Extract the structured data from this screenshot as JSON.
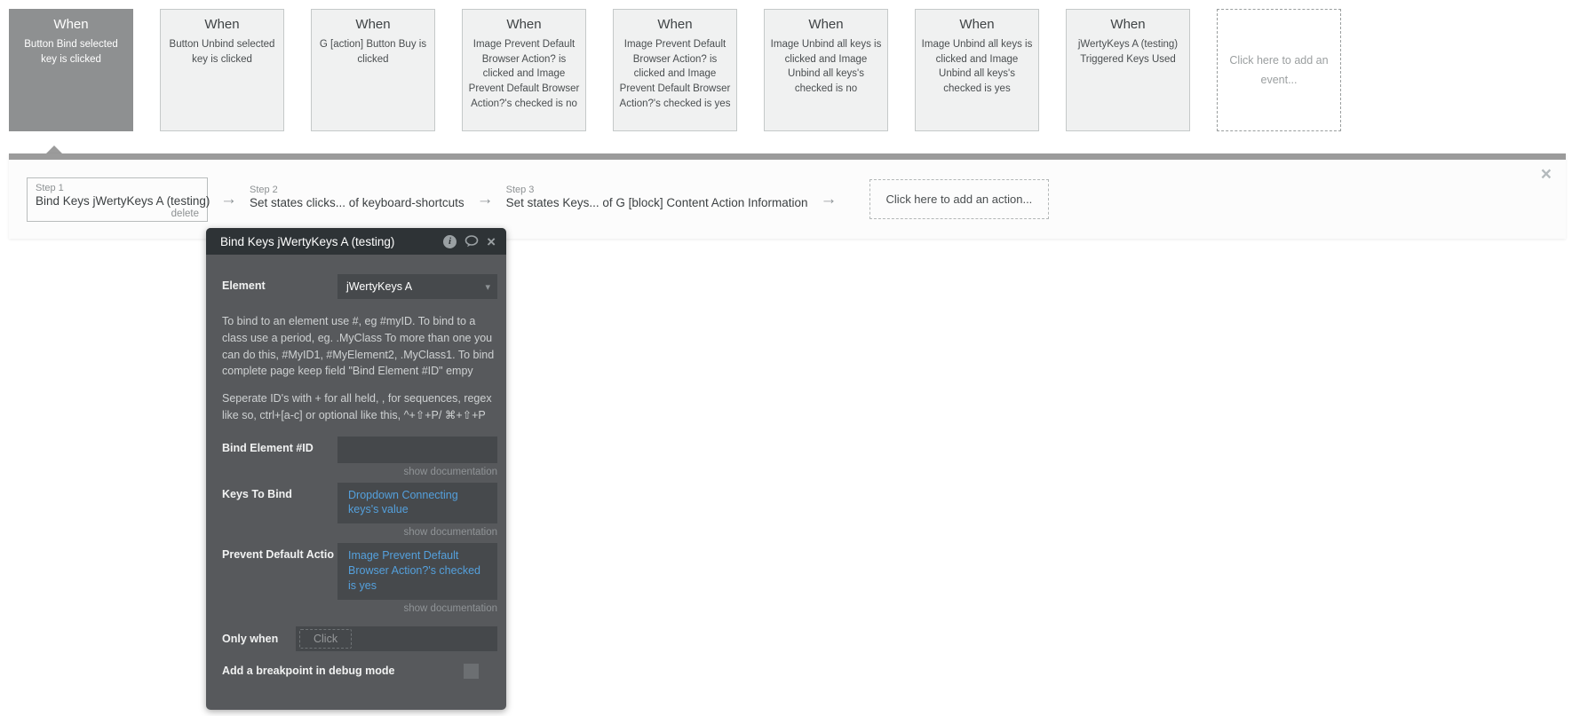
{
  "colors": {
    "accent_blue": "#54a0dc",
    "selected_card_gray": "#8e9091",
    "panel_gray": "#57595c",
    "panel_header_gray": "#2e3336"
  },
  "events": {
    "cards": [
      {
        "title": "When",
        "body": "Button Bind selected key is clicked",
        "selected": true
      },
      {
        "title": "When",
        "body": "Button Unbind selected key is clicked",
        "selected": false
      },
      {
        "title": "When",
        "body": "G [action] Button Buy is clicked",
        "selected": false
      },
      {
        "title": "When",
        "body": "Image Prevent Default Browser Action? is clicked and Image Prevent Default Browser Action?'s checked is no",
        "selected": false
      },
      {
        "title": "When",
        "body": "Image Prevent Default Browser Action? is clicked and Image Prevent Default Browser Action?'s checked is yes",
        "selected": false
      },
      {
        "title": "When",
        "body": "Image Unbind all keys is clicked and Image Unbind all keys's checked is no",
        "selected": false
      },
      {
        "title": "When",
        "body": "Image Unbind all keys is clicked and Image Unbind all keys's checked is yes",
        "selected": false
      },
      {
        "title": "When",
        "body": "jWertyKeys A (testing) Triggered Keys Used",
        "selected": false
      }
    ],
    "add_event_label": "Click here to add an event..."
  },
  "steps_bar": {
    "steps": [
      {
        "step_label": "Step 1",
        "title": "Bind Keys jWertyKeys A (testing)",
        "delete_label": "delete"
      },
      {
        "step_label": "Step 2",
        "title": "Set states clicks... of keyboard-shortcuts"
      },
      {
        "step_label": "Step 3",
        "title": "Set states Keys... of G [block] Content Action Information"
      }
    ],
    "arrow_glyph": "→",
    "add_action_label": "Click here to add an action...",
    "close_glyph": "×"
  },
  "panel": {
    "title": "Bind Keys jWertyKeys A (testing)",
    "info_icon_glyph": "i",
    "close_glyph": "×",
    "element": {
      "label": "Element",
      "value": "jWertyKeys A",
      "caret_glyph": "▾"
    },
    "help_text_1": "To bind to an element use #, eg #myID. To bind to a class use a period, eg. .MyClass To more than one you can do this, #MyID1, #MyElement2, .MyClass1. To bind complete page keep field \"Bind Element #ID\" empy",
    "help_text_2": "Seperate ID's with + for all held, , for sequences, regex like so, ctrl+[a-c] or optional like this, ^+⇧+P/ ⌘+⇧+P",
    "show_documentation_label": "show documentation",
    "bind_element": {
      "label": "Bind Element #ID",
      "value": ""
    },
    "keys_to_bind": {
      "label": "Keys To Bind",
      "value": "Dropdown Connecting keys's value"
    },
    "prevent_default": {
      "label": "Prevent Default Actio",
      "value": "Image Prevent Default Browser Action?'s checked is yes"
    },
    "only_when": {
      "label": "Only when",
      "placeholder": "Click"
    },
    "breakpoint": {
      "label": "Add a breakpoint in debug mode",
      "checked": false
    }
  }
}
